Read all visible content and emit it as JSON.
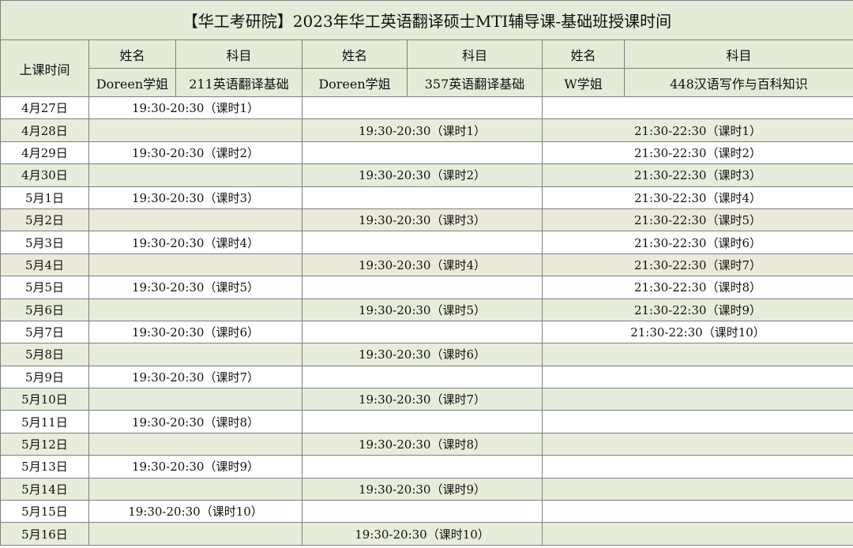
{
  "title": "【华工考研院】2023年华工英语翻译硕士MTI辅导课-基础班授课时间",
  "header": {
    "date_col": "上课时间",
    "name_label": "姓名",
    "subject_label": "科目",
    "teachers": [
      {
        "name": "Doreen学姐",
        "subject": "211英语翻译基础"
      },
      {
        "name": "Doreen学姐",
        "subject": "357英语翻译基础"
      },
      {
        "name": "W学姐",
        "subject": "448汉语写作与百科知识"
      }
    ]
  },
  "rows": [
    {
      "date": "4月27日",
      "s1": "19:30-20:30（课时1）",
      "s2": "",
      "s3": ""
    },
    {
      "date": "4月28日",
      "s1": "",
      "s2": "19:30-20:30（课时1）",
      "s3": "21:30-22:30（课时1）"
    },
    {
      "date": "4月29日",
      "s1": "19:30-20:30（课时2）",
      "s2": "",
      "s3": "21:30-22:30（课时2）"
    },
    {
      "date": "4月30日",
      "s1": "",
      "s2": "19:30-20:30（课时2）",
      "s3": "21:30-22:30（课时3）"
    },
    {
      "date": "5月1日",
      "s1": "19:30-20:30（课时3）",
      "s2": "",
      "s3": "21:30-22:30（课时4）"
    },
    {
      "date": "5月2日",
      "s1": "",
      "s2": "19:30-20:30（课时3）",
      "s3": "21:30-22:30（课时5）"
    },
    {
      "date": "5月3日",
      "s1": "19:30-20:30（课时4）",
      "s2": "",
      "s3": "21:30-22:30（课时6）"
    },
    {
      "date": "5月4日",
      "s1": "",
      "s2": "19:30-20:30（课时4）",
      "s3": "21:30-22:30（课时7）"
    },
    {
      "date": "5月5日",
      "s1": "19:30-20:30（课时5）",
      "s2": "",
      "s3": "21:30-22:30（课时8）"
    },
    {
      "date": "5月6日",
      "s1": "",
      "s2": "19:30-20:30（课时5）",
      "s3": "21:30-22:30（课时9）"
    },
    {
      "date": "5月7日",
      "s1": "19:30-20:30（课时6）",
      "s2": "",
      "s3": "21:30-22:30（课时10）"
    },
    {
      "date": "5月8日",
      "s1": "",
      "s2": "19:30-20:30（课时6）",
      "s3": ""
    },
    {
      "date": "5月9日",
      "s1": "19:30-20:30（课时7）",
      "s2": "",
      "s3": ""
    },
    {
      "date": "5月10日",
      "s1": "",
      "s2": "19:30-20:30（课时7）",
      "s3": ""
    },
    {
      "date": "5月11日",
      "s1": "19:30-20:30（课时8）",
      "s2": "",
      "s3": ""
    },
    {
      "date": "5月12日",
      "s1": "",
      "s2": "19:30-20:30（课时8）",
      "s3": ""
    },
    {
      "date": "5月13日",
      "s1": "19:30-20:30（课时9）",
      "s2": "",
      "s3": ""
    },
    {
      "date": "5月14日",
      "s1": "",
      "s2": "19:30-20:30（课时9）",
      "s3": ""
    },
    {
      "date": "5月15日",
      "s1": "19:30-20:30（课时10）",
      "s2": "",
      "s3": ""
    },
    {
      "date": "5月16日",
      "s1": "",
      "s2": "19:30-20:30（课时10）",
      "s3": ""
    }
  ]
}
